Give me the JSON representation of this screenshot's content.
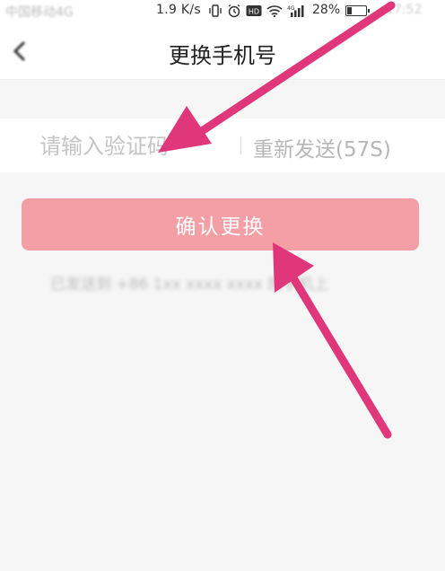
{
  "status_bar": {
    "carrier": "中国移动4G",
    "net_speed": "1.9 K/s",
    "battery_percent": "28%",
    "battery_level": 0.28,
    "time": "17:52",
    "icons": [
      "vibrate-icon",
      "alarm-icon",
      "hd-icon",
      "wifi-icon",
      "signal-icon"
    ]
  },
  "header": {
    "title": "更换手机号",
    "back_icon": "chevron-left-icon"
  },
  "form": {
    "code_placeholder": "请输入验证码",
    "code_value": "",
    "resend_label": "重新发送(57S)",
    "confirm_label": "确认更换"
  },
  "hint": {
    "text": "已发送到 +86 1xx xxxx xxxx 的手机上"
  },
  "colors": {
    "accent_button": "#f49fa6",
    "annotation_arrow": "#e0367a"
  }
}
